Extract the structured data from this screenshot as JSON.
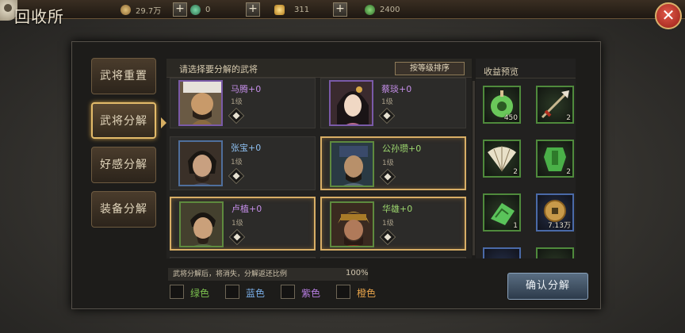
{
  "title": "回收所",
  "resources": [
    {
      "name": "copper-coin",
      "value": "29.7万",
      "color": "#b08a4a",
      "has_plus": true
    },
    {
      "name": "jade",
      "value": "0",
      "color": "#3f8c6a",
      "has_plus": true
    },
    {
      "name": "gold-ingot",
      "value": "311",
      "color": "#d8a43a",
      "has_plus": true
    },
    {
      "name": "green-token",
      "value": "2400",
      "color": "#4f9a4a",
      "has_plus": false
    }
  ],
  "close_icon": "close-icon",
  "tabs": [
    {
      "label": "武将重置",
      "active": false
    },
    {
      "label": "武将分解",
      "active": true
    },
    {
      "label": "好感分解",
      "active": false
    },
    {
      "label": "装备分解",
      "active": false
    }
  ],
  "panel": {
    "hint": "请选择要分解的武将",
    "sort_label": "按等级排序"
  },
  "heroes": [
    {
      "name": "马腾+0",
      "level": "1级",
      "quality": "purple",
      "selected": false
    },
    {
      "name": "蔡琰+0",
      "level": "1级",
      "quality": "purple",
      "selected": false
    },
    {
      "name": "张宝+0",
      "level": "1级",
      "quality": "blue",
      "selected": false
    },
    {
      "name": "公孙瓒+0",
      "level": "1级",
      "quality": "green",
      "selected": true
    },
    {
      "name": "卢植+0",
      "level": "1级",
      "quality": "purple",
      "selected": true
    },
    {
      "name": "华雄+0",
      "level": "1级",
      "quality": "green",
      "selected": true
    }
  ],
  "rewards": {
    "title": "收益预览",
    "items": [
      {
        "icon": "jade-pendant-icon",
        "count": "450",
        "quality": "green"
      },
      {
        "icon": "spear-icon",
        "count": "2",
        "quality": "green"
      },
      {
        "icon": "fan-icon",
        "count": "2",
        "quality": "green"
      },
      {
        "icon": "jade-armor-icon",
        "count": "2",
        "quality": "green"
      },
      {
        "icon": "jade-token-icon",
        "count": "1",
        "quality": "green"
      },
      {
        "icon": "coin-icon",
        "count": "7.13万",
        "quality": "blue"
      }
    ]
  },
  "footer": {
    "note": "武将分解后，将消失，分解返还比例",
    "percent": "100%",
    "filters": [
      {
        "label": "绿色",
        "color": "#7cc24e"
      },
      {
        "label": "蓝色",
        "color": "#7aaee8"
      },
      {
        "label": "紫色",
        "color": "#b67de0"
      },
      {
        "label": "橙色",
        "color": "#e8a44a"
      }
    ],
    "confirm_label": "确认分解"
  }
}
